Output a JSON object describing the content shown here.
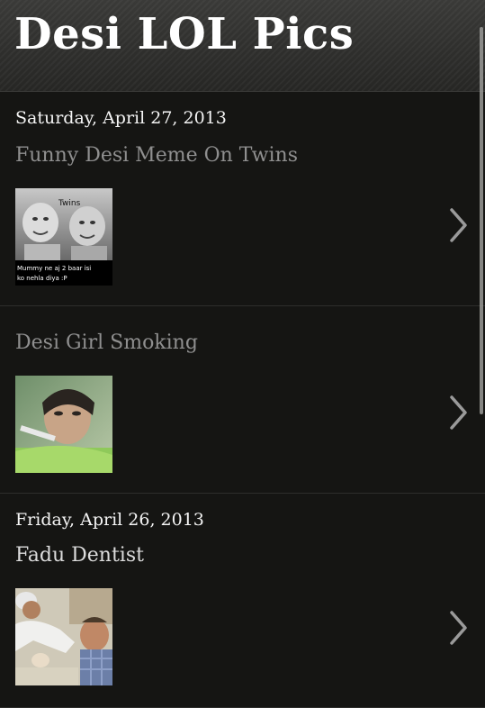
{
  "header": {
    "title": "Desi LOL Pics"
  },
  "posts": [
    {
      "date": "Saturday, April 27, 2013",
      "title": "Funny Desi Meme On Twins",
      "thumb_caption_top": "Twins",
      "thumb_caption_bottom_1": "Mummy ne aj 2 baar isi",
      "thumb_caption_bottom_2": "ko nehla diya :P"
    },
    {
      "date": "",
      "title": "Desi Girl Smoking"
    },
    {
      "date": "Friday, April 26, 2013",
      "title": "Fadu Dentist"
    }
  ],
  "icons": {
    "next": "chevron-right-icon"
  },
  "colors": {
    "background": "#151513",
    "header_bg": "#2e2e2c",
    "title_text": "#ffffff",
    "post_title_dim": "#8f8f8f",
    "post_title_active": "#dcdcdc",
    "divider": "#2e2e2c"
  }
}
